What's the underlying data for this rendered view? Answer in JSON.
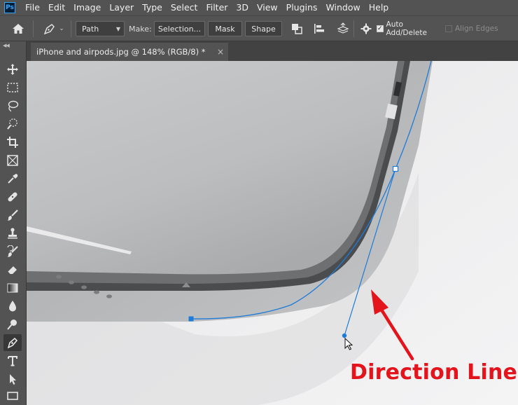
{
  "app": {
    "logo_text": "Ps"
  },
  "menu": [
    "File",
    "Edit",
    "Image",
    "Layer",
    "Type",
    "Select",
    "Filter",
    "3D",
    "View",
    "Plugins",
    "Window",
    "Help"
  ],
  "options_bar": {
    "mode_value": "Path",
    "make_label": "Make:",
    "selection_label": "Selection...",
    "mask_label": "Mask",
    "shape_label": "Shape",
    "auto_add_delete_label": "Auto Add/Delete",
    "auto_add_delete_checked": true,
    "align_edges_label": "Align Edges",
    "align_edges_checked": false
  },
  "document_tab": {
    "title": "iPhone and airpods.jpg @ 148% (RGB/8) *",
    "close": "×"
  },
  "tools": [
    "move-tool",
    "marquee-tool",
    "lasso-tool",
    "quick-selection-tool",
    "crop-tool",
    "frame-tool",
    "eyedropper-tool",
    "spot-healing-tool",
    "brush-tool",
    "clone-stamp-tool",
    "history-brush-tool",
    "eraser-tool",
    "gradient-tool",
    "blur-tool",
    "dodge-tool",
    "pen-tool",
    "type-tool",
    "path-selection-tool",
    "rectangle-tool"
  ],
  "active_tool": "pen-tool",
  "annotation": {
    "text": "Direction Line",
    "color": "#e3141b"
  },
  "colors": {
    "path": "#1e7bd9",
    "arrow": "#e3141b",
    "ui_panel": "#535353"
  }
}
